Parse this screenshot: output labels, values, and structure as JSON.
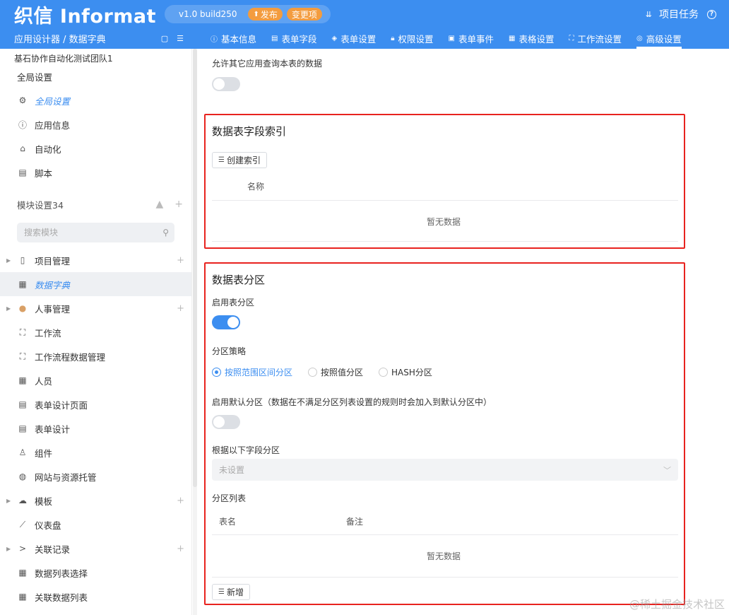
{
  "app": {
    "logo": "织信 Informat",
    "version": "v1.0 build250",
    "publish_label": "发布",
    "changes_label": "变更项",
    "project_tasks": "项目任务"
  },
  "breadcrumb": "应用设计器 / 数据字典",
  "tabs": [
    {
      "label": "基本信息",
      "icon": "info"
    },
    {
      "label": "表单字段",
      "icon": "form"
    },
    {
      "label": "表单设置",
      "icon": "layers"
    },
    {
      "label": "权限设置",
      "icon": "lock"
    },
    {
      "label": "表单事件",
      "icon": "event"
    },
    {
      "label": "表格设置",
      "icon": "table"
    },
    {
      "label": "工作流设置",
      "icon": "flow"
    },
    {
      "label": "高级设置",
      "icon": "database"
    }
  ],
  "sidebar": {
    "team": "基石协作自动化测试团队1",
    "global_title": "全局设置",
    "global_items": [
      {
        "label": "全局设置",
        "icon": "gear-icon"
      },
      {
        "label": "应用信息",
        "icon": "info-icon"
      },
      {
        "label": "自动化",
        "icon": "robot-icon"
      },
      {
        "label": "脚本",
        "icon": "script-icon"
      }
    ],
    "modules_title": "模块设置34",
    "search_placeholder": "搜索模块",
    "modules": [
      {
        "label": "项目管理",
        "icon": "file-icon",
        "caret": true,
        "plus": true
      },
      {
        "label": "数据字典",
        "icon": "table-icon",
        "caret": false,
        "plus": false
      },
      {
        "label": "人事管理",
        "icon": "avatar-icon",
        "caret": true,
        "plus": true
      },
      {
        "label": "工作流",
        "icon": "flow-icon",
        "caret": false,
        "plus": false
      },
      {
        "label": "工作流程数据管理",
        "icon": "flow-icon",
        "caret": false,
        "plus": false
      },
      {
        "label": "人员",
        "icon": "table-icon",
        "caret": false,
        "plus": false
      },
      {
        "label": "表单设计页面",
        "icon": "doc-icon",
        "caret": false,
        "plus": false
      },
      {
        "label": "表单设计",
        "icon": "doc-icon",
        "caret": false,
        "plus": false
      },
      {
        "label": "组件",
        "icon": "user-icon",
        "caret": false,
        "plus": false
      },
      {
        "label": "网站与资源托管",
        "icon": "globe-icon",
        "caret": false,
        "plus": false
      },
      {
        "label": "模板",
        "icon": "cloud-icon",
        "caret": true,
        "plus": true
      },
      {
        "label": "仪表盘",
        "icon": "chart-icon",
        "caret": false,
        "plus": false
      },
      {
        "label": "关联记录",
        "icon": "link-icon",
        "caret": true,
        "plus": true
      },
      {
        "label": "数据列表选择",
        "icon": "table-icon",
        "caret": false,
        "plus": false
      },
      {
        "label": "关联数据列表",
        "icon": "table-icon",
        "caret": false,
        "plus": false
      }
    ]
  },
  "main": {
    "allow_query_label": "允许其它应用查询本表的数据",
    "allow_query_on": false,
    "index_section": {
      "title": "数据表字段索引",
      "create_button": "创建索引",
      "column_name": "名称",
      "empty_text": "暂无数据"
    },
    "partition_section": {
      "title": "数据表分区",
      "enable_label": "启用表分区",
      "enable_on": true,
      "strategy_label": "分区策略",
      "strategies": [
        {
          "label": "按照范围区间分区",
          "checked": true
        },
        {
          "label": "按照值分区",
          "checked": false
        },
        {
          "label": "HASH分区",
          "checked": false
        }
      ],
      "default_partition_label": "启用默认分区（数据在不满足分区列表设置的规则时会加入到默认分区中）",
      "default_partition_on": false,
      "field_label": "根据以下字段分区",
      "field_placeholder": "未设置",
      "list_label": "分区列表",
      "col_table_name": "表名",
      "col_remark": "备注",
      "empty_text": "暂无数据",
      "add_button": "新增"
    }
  },
  "watermark": "@稀土掘金技术社区"
}
